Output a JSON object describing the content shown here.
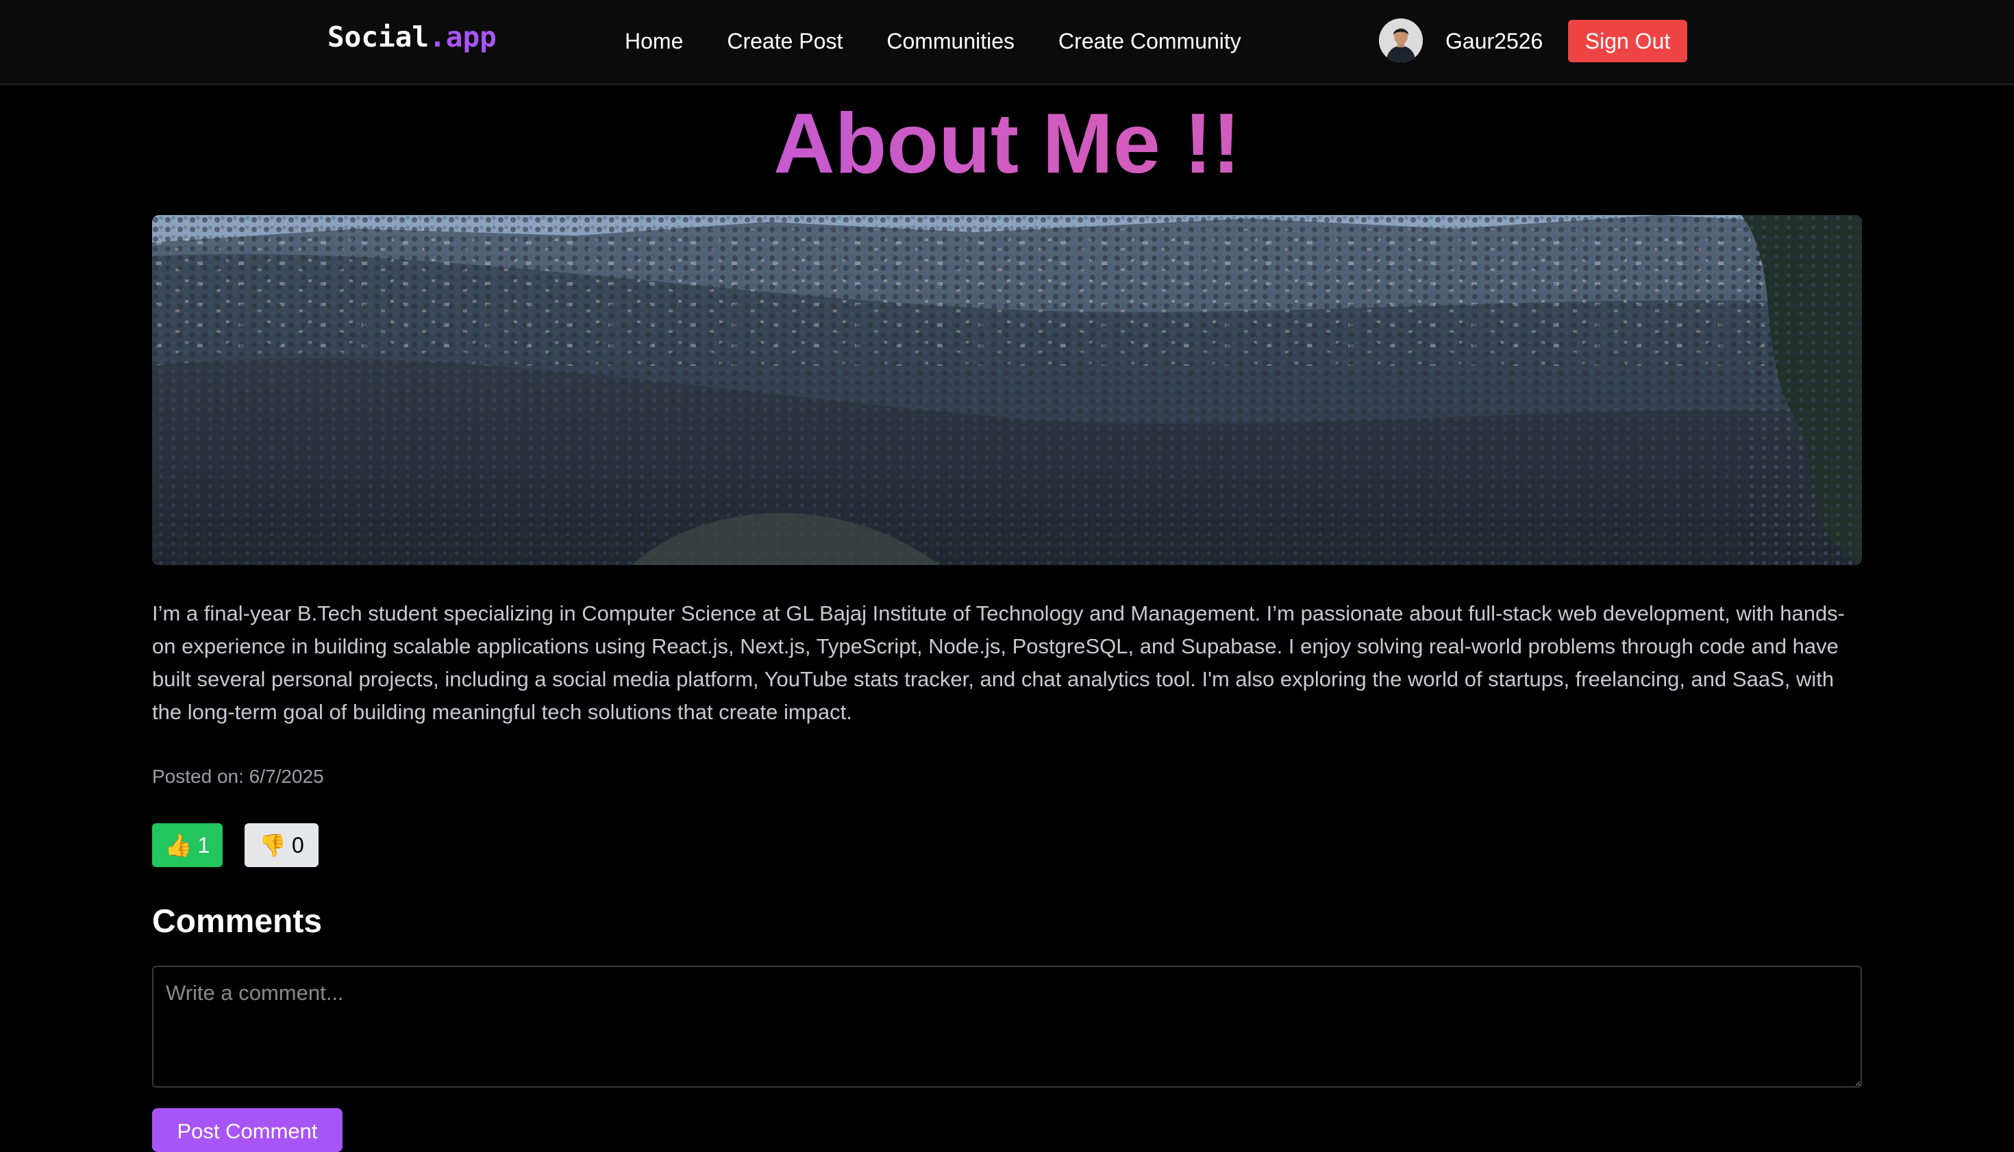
{
  "nav": {
    "logo_main": "Social",
    "logo_accent": ".app",
    "links": [
      "Home",
      "Create Post",
      "Communities",
      "Create Community"
    ],
    "username": "Gaur2526",
    "signout_label": "Sign Out"
  },
  "post": {
    "title": "About Me !!",
    "content": "I’m a final-year B.Tech student specializing in Computer Science at GL Bajaj Institute of Technology and Management. I’m passionate about full-stack web development, with hands-on experience in building scalable applications using React.js, Next.js, TypeScript, Node.js, PostgreSQL, and Supabase. I enjoy solving real-world problems through code and have built several personal projects, including a social media platform, YouTube stats tracker, and chat analytics tool. I'm also exploring the world of startups, freelancing, and SaaS, with the long-term goal of building meaningful tech solutions that create impact.",
    "posted_on": "Posted on: 6/7/2025",
    "likes": {
      "icon": "👍",
      "count": "1"
    },
    "dislikes": {
      "icon": "👎",
      "count": "0"
    }
  },
  "comments": {
    "heading": "Comments",
    "placeholder": "Write a comment...",
    "submit_label": "Post Comment"
  },
  "colors": {
    "accent": "#a855f7",
    "signout": "#ef4444",
    "like": "#22c55e",
    "dislike": "#e5e7eb"
  }
}
